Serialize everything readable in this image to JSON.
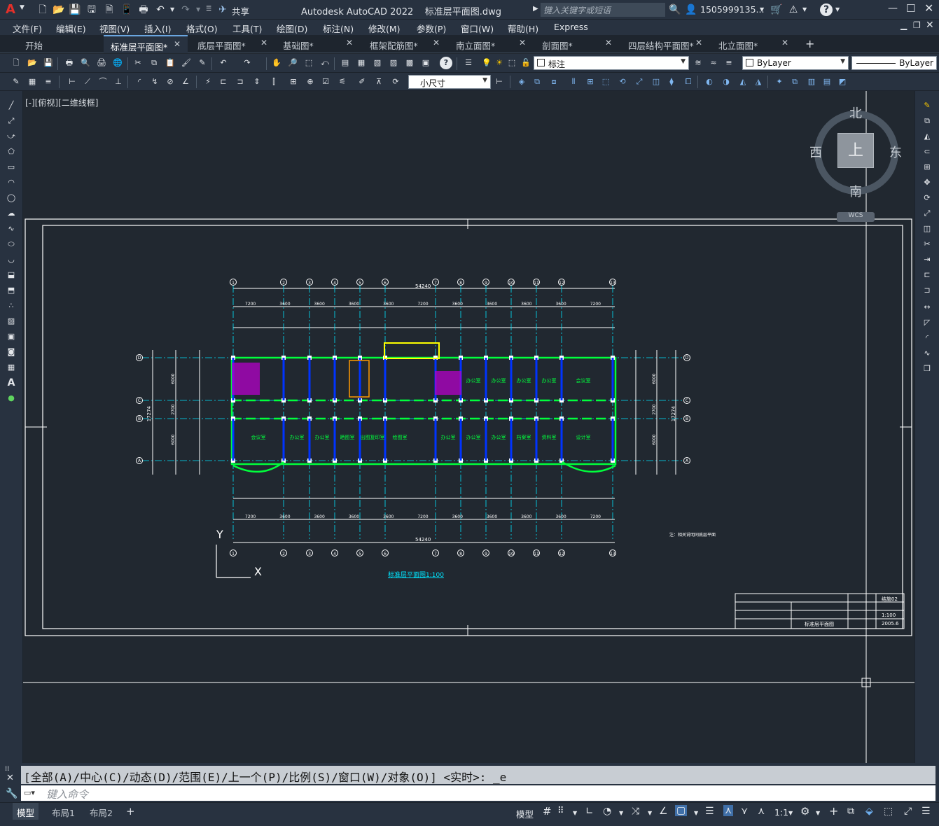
{
  "app": {
    "title": "Autodesk AutoCAD 2022",
    "filename": "标准层平面图.dwg",
    "share": "共享",
    "search_placeholder": "键入关键字或短语",
    "user": "1505999135...",
    "logo": "A"
  },
  "menu": [
    "文件(F)",
    "编辑(E)",
    "视图(V)",
    "插入(I)",
    "格式(O)",
    "工具(T)",
    "绘图(D)",
    "标注(N)",
    "修改(M)",
    "参数(P)",
    "窗口(W)",
    "帮助(H)",
    "Express"
  ],
  "tabs": [
    {
      "label": "开始"
    },
    {
      "label": "标准层平面图*"
    },
    {
      "label": "底层平面图*"
    },
    {
      "label": "基础图*"
    },
    {
      "label": "框架配筋图*"
    },
    {
      "label": "南立面图*"
    },
    {
      "label": "剖面图*"
    },
    {
      "label": "四层结构平面图*"
    },
    {
      "label": "北立面图*"
    }
  ],
  "toolbar": {
    "layer_name": "标注",
    "color": "ByLayer",
    "linetype": "ByLayer",
    "dimstyle": "小尺寸"
  },
  "viewport": {
    "label": "[-][俯视][二维线框]",
    "viewcube_top": "上",
    "viewcube_n": "北",
    "viewcube_s": "南",
    "viewcube_e": "东",
    "viewcube_w": "西",
    "wcs": "WCS",
    "ucs_x": "X",
    "ucs_y": "Y"
  },
  "drawing": {
    "title": "标准层平面图1:100",
    "note": "注：相关说明同底层平面",
    "total_dim": "54240",
    "axes_top": [
      "1",
      "2",
      "3",
      "4",
      "5",
      "6",
      "7",
      "8",
      "9",
      "10",
      "11",
      "12",
      "13"
    ],
    "axes_side": [
      "D",
      "C",
      "B",
      "A"
    ],
    "top_dims": [
      "7200",
      "3600",
      "3600",
      "3600",
      "3600",
      "7200",
      "3600",
      "3600",
      "3600",
      "3600",
      "7200"
    ],
    "bottom_dims": [
      "7200",
      "3600",
      "3600",
      "3600",
      "3600",
      "7200",
      "3600",
      "3600",
      "3600",
      "3600",
      "7200"
    ],
    "side_dims": [
      "6000",
      "2700",
      "6000"
    ],
    "side_total": "17274",
    "rooms_top": [
      "办公室",
      "办公室",
      "办公室",
      "办公室",
      "会议室"
    ],
    "rooms_bottom": [
      "会议室",
      "办公室",
      "办公室",
      "晒图室",
      "出图复印室",
      "绘图室",
      "办公室",
      "办公室",
      "办公室",
      "档案室",
      "资料室",
      "设计室"
    ],
    "titleblock": {
      "scale": "1:100",
      "drawing_name": "标准层平面图",
      "sheet": "结施02",
      "date": "2005.6"
    }
  },
  "command": {
    "history": "[全部(A)/中心(C)/动态(D)/范围(E)/上一个(P)/比例(S)/窗口(W)/对象(O)] <实时>: _e",
    "placeholder": "键入命令"
  },
  "status": {
    "tabs": [
      "模型",
      "布局1",
      "布局2"
    ],
    "model_button": "模型",
    "scale": "1:1"
  },
  "colors": {
    "bg": "#212830",
    "wall": "#00ff3c",
    "column": "#0033ff",
    "dim": "#ffffff",
    "axis": "#00e5ff",
    "title_text": "#00e5ff"
  }
}
